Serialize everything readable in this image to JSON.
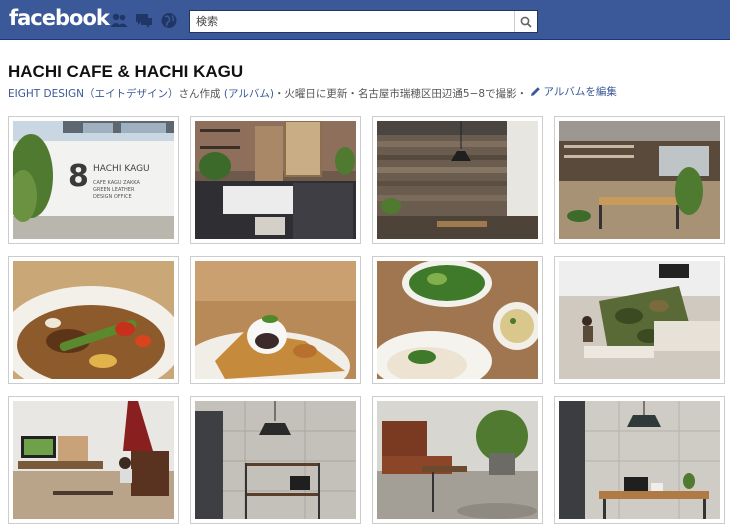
{
  "header": {
    "logo": "facebook",
    "search": {
      "placeholder": "検索"
    },
    "icons": [
      "friends-icon",
      "messages-icon",
      "notifications-globe-icon",
      "search-icon"
    ]
  },
  "album": {
    "title": "HACHI CAFE & HACHI KAGU",
    "author": "EIGHT DESIGN（エイトデザイン）",
    "author_suffix": "さん作成",
    "album_link": "(アルバム)",
    "updated": "・火曜日に更新・",
    "location": "名古屋市瑞穂区田辺通5−8で撮影・",
    "edit_label": "アルバムを編集"
  },
  "photos": [
    {
      "subject": "storefront-sign",
      "sign": {
        "number": "8",
        "name": "HACHI KAGU",
        "tagline": [
          "CAFE KAGU ZAKKA",
          "GREEN LEATHER",
          "DESIGN OFFICE"
        ]
      }
    },
    {
      "subject": "cafe-counter-with-shelves"
    },
    {
      "subject": "wood-wall-interior-pendant-lamp"
    },
    {
      "subject": "cafe-dining-room"
    },
    {
      "subject": "curry-with-vegetables"
    },
    {
      "subject": "dessert-waffle"
    },
    {
      "subject": "salad-soup-rice-set"
    },
    {
      "subject": "camouflage-sofa-living-area"
    },
    {
      "subject": "living-room-with-tv-and-chair"
    },
    {
      "subject": "shelf-under-pendant-lamp"
    },
    {
      "subject": "leather-armchair-plant"
    },
    {
      "subject": "desk-with-laptop-and-lamp"
    }
  ]
}
